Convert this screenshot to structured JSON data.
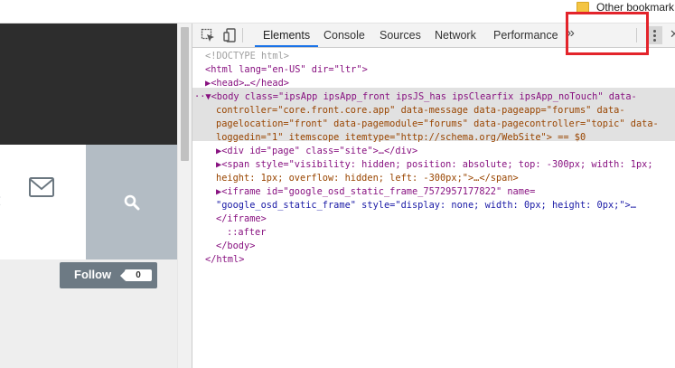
{
  "bookmark_bar": {
    "label": "Other bookmark"
  },
  "site": {
    "follow_label": "Follow",
    "follow_count": "0"
  },
  "devtools": {
    "tabs": [
      "Elements",
      "Console",
      "Sources",
      "Network",
      "Performance"
    ],
    "active_tab": "Elements",
    "more_tabs_icon": "»",
    "dom_lines": [
      "<!DOCTYPE html>",
      "<html lang=\"en-US\" dir=\"ltr\">",
      "▶<head>…</head>",
      "··▼<body class=\"ipsApp ipsApp_front ipsJS_has ipsClearfix ipsApp_noTouch\" data-",
      "controller=\"core.front.core.app\" data-message data-pageapp=\"forums\" data-",
      "pagelocation=\"front\" data-pagemodule=\"forums\" data-pagecontroller=\"topic\" data-",
      "loggedin=\"1\" itemscope itemtype=\"http://schema.org/WebSite\"> == $0",
      "▶<div id=\"page\" class=\"site\">…</div>",
      "▶<span style=\"visibility: hidden; position: absolute; top: -300px; width: 1px;",
      "height: 1px; overflow: hidden; left: -300px;\">…</span>",
      "▶<iframe id=\"google_osd_static_frame_7572957177822\" name=",
      "\"google_osd_static_frame\" style=\"display: none; width: 0px; height: 0px;\">…",
      "</iframe>",
      "::after",
      "</body>",
      "</html>"
    ]
  },
  "colors": {
    "site_header": "#2d2d2d",
    "search_tile": "#b3bcc4",
    "follow_button": "#6d7a84",
    "highlight_box": "#e3242b",
    "active_tab_underline": "#1a73e8"
  }
}
